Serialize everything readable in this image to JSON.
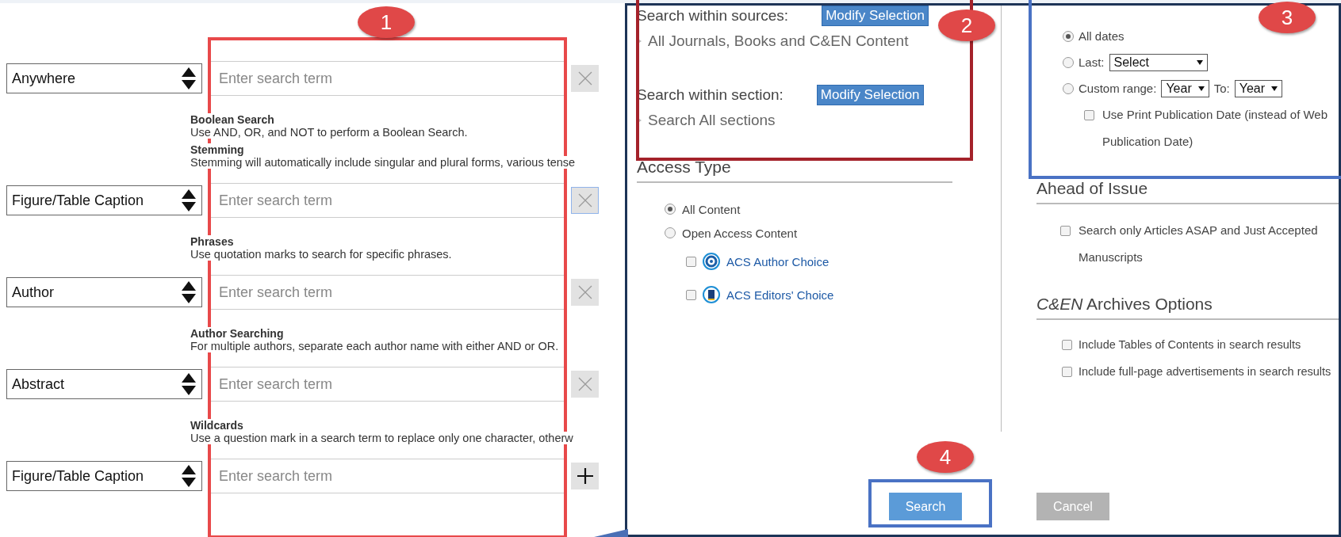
{
  "search_rows": [
    {
      "field": "Anywhere",
      "placeholder": "Enter search term",
      "kind": "remove",
      "focused": false,
      "hints": [
        {
          "title": "Boolean Search",
          "text": "Use AND, OR, and NOT to perform a Boolean Search."
        },
        {
          "title": "Stemming",
          "text": "Stemming will automatically include singular and plural forms, various tense"
        }
      ]
    },
    {
      "field": "Figure/Table Caption",
      "placeholder": "Enter search term",
      "kind": "remove",
      "focused": true,
      "hints": [
        {
          "title": "Phrases",
          "text": "Use quotation marks to search for specific phrases."
        }
      ]
    },
    {
      "field": "Author",
      "placeholder": "Enter search term",
      "kind": "remove",
      "focused": false,
      "hints": [
        {
          "title": "Author Searching",
          "text": "For multiple authors, separate each author name with either AND or OR."
        }
      ]
    },
    {
      "field": "Abstract",
      "placeholder": "Enter search term",
      "kind": "remove",
      "focused": false,
      "hints": [
        {
          "title": "Wildcards",
          "text": "Use a question mark in a search term to replace only one character, otherw"
        }
      ]
    },
    {
      "field": "Figure/Table Caption",
      "placeholder": "Enter search term",
      "kind": "add",
      "focused": false
    }
  ],
  "sources": {
    "label": "Search within sources:",
    "button": "Modify Selection",
    "value": "All Journals, Books and C&EN Content"
  },
  "section": {
    "label": "Search within section:",
    "button": "Modify Selection",
    "value": "Search All sections"
  },
  "access_type": {
    "heading": "Access Type",
    "options": [
      {
        "label": "All Content",
        "selected": true
      },
      {
        "label": "Open Access Content",
        "selected": false
      }
    ],
    "choices": [
      {
        "label": "ACS Author Choice",
        "checked": false,
        "kind": "swirl"
      },
      {
        "label": "ACS Editors' Choice",
        "checked": false,
        "kind": "book"
      }
    ]
  },
  "date_range": {
    "options": [
      {
        "kind": "all",
        "label": "All dates",
        "selected": true
      },
      {
        "kind": "last",
        "label": "Last:",
        "select": "Select",
        "selected": false
      },
      {
        "kind": "custom",
        "label": "Custom range:",
        "from": "Year",
        "to_label": "To:",
        "to": "Year",
        "selected": false
      }
    ],
    "print_date": {
      "label": "Use Print Publication Date (instead of Web Publication Date)",
      "checked": false
    }
  },
  "ahead_of_issue": {
    "heading": "Ahead of Issue",
    "options": [
      {
        "label": "Search only Articles ASAP and Just Accepted Manuscripts",
        "checked": false
      }
    ]
  },
  "archives": {
    "heading": "*C&EN* Archives Options",
    "options": [
      {
        "label": "Include Tables of Contents in search results",
        "checked": false
      },
      {
        "label": "Include full-page advertisements in search results",
        "checked": false
      }
    ]
  },
  "buttons": [
    {
      "kind": "primary",
      "label": "Search"
    },
    {
      "kind": "secondary",
      "label": "Cancel"
    }
  ],
  "callouts": [
    {
      "number": "1",
      "color": "#e8494a"
    },
    {
      "number": "2",
      "color": "#a4222a"
    },
    {
      "number": "3",
      "color": "#4a72c4"
    },
    {
      "number": "4",
      "color": "#4a72c4"
    }
  ]
}
